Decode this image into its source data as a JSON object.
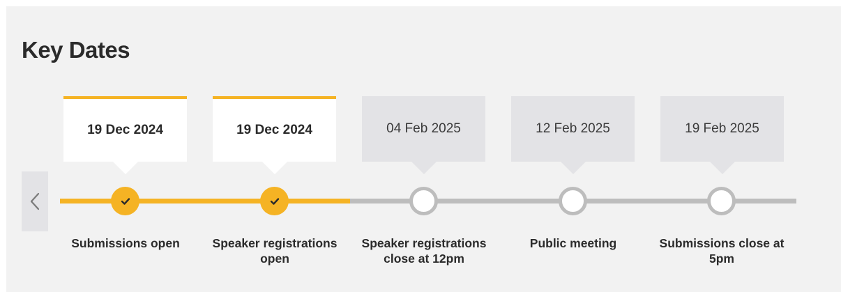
{
  "section": {
    "title": "Key Dates"
  },
  "icons": {
    "prev": "chevron-left-icon",
    "check": "check-icon"
  },
  "colors": {
    "accent": "#f5b324",
    "inactive": "#bdbdbd",
    "card_inactive": "#e3e3e6",
    "panel": "#f2f2f2"
  },
  "timeline": {
    "milestones": [
      {
        "date": "19 Dec 2024",
        "label": "Submissions open",
        "status": "complete"
      },
      {
        "date": "19 Dec 2024",
        "label": "Speaker registrations open",
        "status": "complete"
      },
      {
        "date": "04 Feb 2025",
        "label": "Speaker registrations close at 12pm",
        "status": "upcoming"
      },
      {
        "date": "12 Feb 2025",
        "label": "Public meeting",
        "status": "upcoming"
      },
      {
        "date": "19 Feb 2025",
        "label": "Submissions close at 5pm",
        "status": "upcoming"
      }
    ]
  }
}
